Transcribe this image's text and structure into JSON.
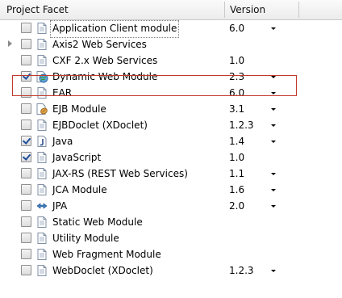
{
  "header": {
    "facet_label": "Project Facet",
    "version_label": "Version"
  },
  "rows": [
    {
      "label": "Application Client module",
      "version": "6.0",
      "checked": false,
      "icon": "document-icon",
      "has_dropdown": true,
      "expandable": false,
      "boxed": true
    },
    {
      "label": "Axis2 Web Services",
      "version": "",
      "checked": false,
      "icon": "document-icon",
      "has_dropdown": false,
      "expandable": true,
      "boxed": false
    },
    {
      "label": "CXF 2.x Web Services",
      "version": "1.0",
      "checked": false,
      "icon": "document-icon",
      "has_dropdown": false,
      "expandable": false,
      "boxed": false
    },
    {
      "label": "Dynamic Web Module",
      "version": "2.3",
      "checked": true,
      "icon": "web-globe-icon",
      "has_dropdown": true,
      "expandable": false,
      "boxed": false,
      "highlighted": true
    },
    {
      "label": "EAR",
      "version": "6.0",
      "checked": false,
      "icon": "document-icon",
      "has_dropdown": true,
      "expandable": false,
      "boxed": false
    },
    {
      "label": "EJB Module",
      "version": "3.1",
      "checked": false,
      "icon": "ejb-bean-icon",
      "has_dropdown": true,
      "expandable": false,
      "boxed": false
    },
    {
      "label": "EJBDoclet (XDoclet)",
      "version": "1.2.3",
      "checked": false,
      "icon": "document-icon",
      "has_dropdown": true,
      "expandable": false,
      "boxed": false
    },
    {
      "label": "Java",
      "version": "1.4",
      "checked": true,
      "icon": "java-icon",
      "has_dropdown": true,
      "expandable": false,
      "boxed": false
    },
    {
      "label": "JavaScript",
      "version": "1.0",
      "checked": true,
      "icon": "document-icon",
      "has_dropdown": false,
      "expandable": false,
      "boxed": false
    },
    {
      "label": "JAX-RS (REST Web Services)",
      "version": "1.1",
      "checked": false,
      "icon": "document-icon",
      "has_dropdown": true,
      "expandable": false,
      "boxed": false
    },
    {
      "label": "JCA Module",
      "version": "1.6",
      "checked": false,
      "icon": "document-icon",
      "has_dropdown": true,
      "expandable": false,
      "boxed": false
    },
    {
      "label": "JPA",
      "version": "2.0",
      "checked": false,
      "icon": "jpa-arrows-icon",
      "has_dropdown": true,
      "expandable": false,
      "boxed": false
    },
    {
      "label": "Static Web Module",
      "version": "",
      "checked": false,
      "icon": "document-icon",
      "has_dropdown": false,
      "expandable": false,
      "boxed": false
    },
    {
      "label": "Utility Module",
      "version": "",
      "checked": false,
      "icon": "document-icon",
      "has_dropdown": false,
      "expandable": false,
      "boxed": false
    },
    {
      "label": "Web Fragment Module",
      "version": "",
      "checked": false,
      "icon": "document-icon",
      "has_dropdown": false,
      "expandable": false,
      "boxed": false
    },
    {
      "label": "WebDoclet (XDoclet)",
      "version": "1.2.3",
      "checked": false,
      "icon": "document-icon",
      "has_dropdown": true,
      "expandable": false,
      "boxed": false
    }
  ],
  "colors": {
    "highlight_border": "#c0392b",
    "check_color": "#1d4f9c"
  }
}
